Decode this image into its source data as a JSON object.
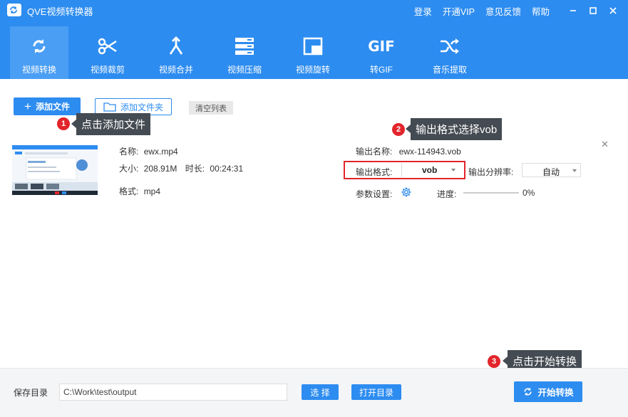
{
  "app": {
    "title": "QVE视频转换器"
  },
  "top_links": [
    "登录",
    "开通VIP",
    "意见反馈",
    "帮助"
  ],
  "toolbar": {
    "items": [
      {
        "label": "视频转换",
        "icon": "sync-icon",
        "active": true
      },
      {
        "label": "视频裁剪",
        "icon": "scissors-icon",
        "active": false
      },
      {
        "label": "视频合并",
        "icon": "merge-icon",
        "active": false
      },
      {
        "label": "视频压缩",
        "icon": "compress-icon",
        "active": false
      },
      {
        "label": "视频旋转",
        "icon": "rotate-icon",
        "active": false
      },
      {
        "label": "转GIF",
        "icon": "gif-icon",
        "icon_text": "GIF",
        "active": false
      },
      {
        "label": "音乐提取",
        "icon": "shuffle-icon",
        "active": false
      }
    ]
  },
  "actions": {
    "add_file": "添加文件",
    "add_folder": "添加文件夹",
    "clear_list": "清空列表"
  },
  "callouts": [
    {
      "number": "1",
      "text": "点击添加文件"
    },
    {
      "number": "2",
      "text": "输出格式选择vob"
    },
    {
      "number": "3",
      "text": "点击开始转换"
    }
  ],
  "file": {
    "name_label": "名称:",
    "name": "ewx.mp4",
    "size_label": "大小:",
    "size": "208.91M",
    "duration_label": "时长:",
    "duration": "00:24:31",
    "format_label": "格式:",
    "format": "mp4",
    "output_name_label": "输出名称:",
    "output_name": "ewx-114943.vob",
    "output_format_label": "输出格式:",
    "output_format": "vob",
    "resolution_label": "输出分辨率:",
    "resolution": "自动",
    "params_label": "参数设置:",
    "progress_label": "进度:",
    "progress_text": "0%",
    "progress": 0
  },
  "bottom": {
    "save_label": "保存目录",
    "save_path": "C:\\Work\\test\\output",
    "select_button": "选 择",
    "open_button": "打开目录",
    "start_button": "开始转换"
  },
  "colors": {
    "primary": "#2d8cf0",
    "callout_red": "#e2252b",
    "tip_bg": "#444b52"
  }
}
